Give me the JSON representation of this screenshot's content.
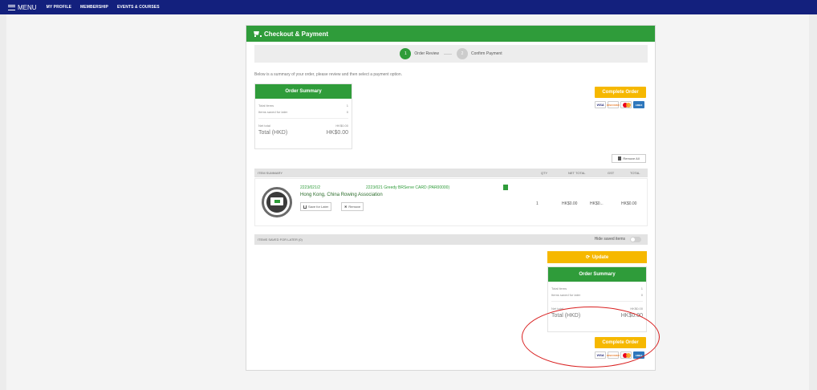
{
  "nav": {
    "menu": "MENU",
    "links": [
      "MY PROFILE",
      "MEMBERSHIP",
      "EVENTS & COURSES"
    ]
  },
  "panel": {
    "title": "Checkout & Payment",
    "steps": [
      {
        "num": "1",
        "label": "Order Review"
      },
      {
        "num": "2",
        "label": "Confirm Payment"
      }
    ],
    "intro": "Below is a summary of your order, please review and then select a payment option."
  },
  "summary": {
    "title": "Order Summary",
    "rows": [
      {
        "label": "Total items",
        "value": "1"
      },
      {
        "label": "Items saved for later",
        "value": "0"
      }
    ],
    "net_label": "Net total",
    "net_value": "HK$0.00",
    "total_label": "Total (HKD)",
    "total_value": "HK$0.00"
  },
  "complete_label": "Complete Order",
  "cards": [
    "VISA",
    "DISCOVER",
    "MASTERCARD",
    "AMEX"
  ],
  "remove_all": "Remove All",
  "items_header": {
    "item_summary": "ITEM SUMMARY",
    "qty": "QTY",
    "net_total": "NET TOTAL",
    "gst": "GST",
    "total": "TOTAL"
  },
  "item": {
    "code": "2223/021/2",
    "description": "2223/021 Greedy BRServe CARD (PAR00000)",
    "org": "Hong Kong, China Rowing Association",
    "save_label": "Save for Later",
    "remove_label": "Remove",
    "qty": "1",
    "net": "HK$0.00",
    "gst": "HK$0...",
    "total": "HK$0.00"
  },
  "saved": {
    "label": "ITEMS SAVED FOR LATER (0)",
    "hide_label": "Hide saved items"
  },
  "update_label": "Update"
}
